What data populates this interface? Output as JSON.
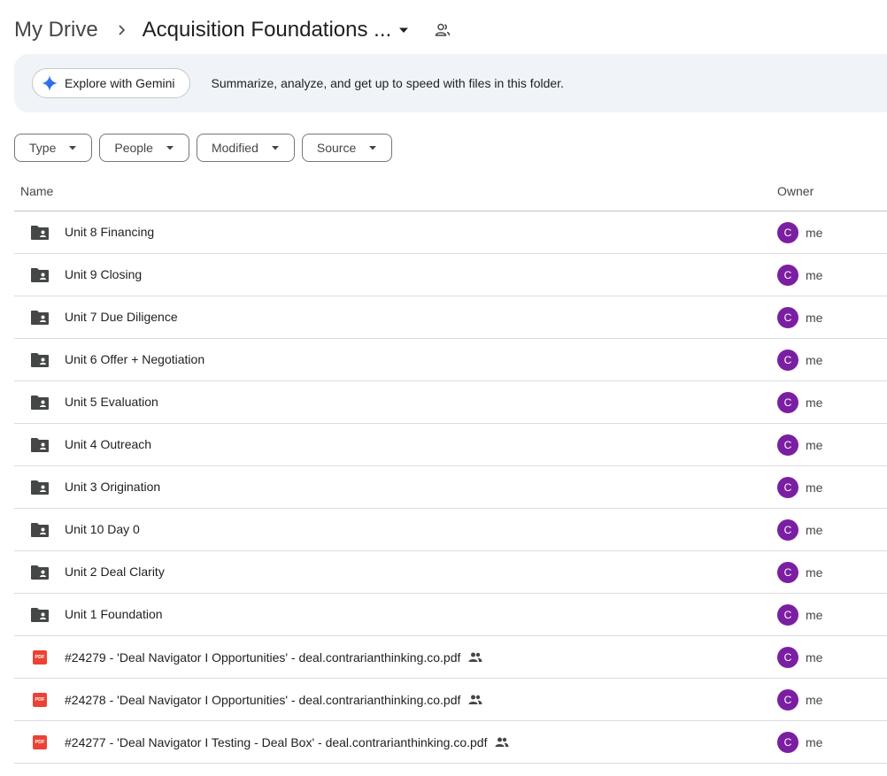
{
  "breadcrumb": {
    "root": "My Drive",
    "current": "Acquisition Foundations ..."
  },
  "gemini": {
    "button_label": "Explore with Gemini",
    "description": "Summarize, analyze, and get up to speed with files in this folder."
  },
  "filters": [
    "Type",
    "People",
    "Modified",
    "Source"
  ],
  "table": {
    "headers": {
      "name": "Name",
      "owner": "Owner"
    },
    "rows": [
      {
        "name": "Unit 8 Financing",
        "type": "shared-folder",
        "owner": "me",
        "avatar": "C",
        "shared": false
      },
      {
        "name": "Unit 9 Closing",
        "type": "shared-folder",
        "owner": "me",
        "avatar": "C",
        "shared": false
      },
      {
        "name": "Unit 7 Due Diligence",
        "type": "shared-folder",
        "owner": "me",
        "avatar": "C",
        "shared": false
      },
      {
        "name": "Unit 6 Offer + Negotiation",
        "type": "shared-folder",
        "owner": "me",
        "avatar": "C",
        "shared": false
      },
      {
        "name": "Unit 5 Evaluation",
        "type": "shared-folder",
        "owner": "me",
        "avatar": "C",
        "shared": false
      },
      {
        "name": "Unit 4 Outreach",
        "type": "shared-folder",
        "owner": "me",
        "avatar": "C",
        "shared": false
      },
      {
        "name": "Unit 3 Origination",
        "type": "shared-folder",
        "owner": "me",
        "avatar": "C",
        "shared": false
      },
      {
        "name": "Unit 10 Day 0",
        "type": "shared-folder",
        "owner": "me",
        "avatar": "C",
        "shared": false
      },
      {
        "name": "Unit 2 Deal Clarity",
        "type": "shared-folder",
        "owner": "me",
        "avatar": "C",
        "shared": false
      },
      {
        "name": "Unit 1 Foundation",
        "type": "shared-folder",
        "owner": "me",
        "avatar": "C",
        "shared": false
      },
      {
        "name": "#24279 - 'Deal Navigator I Opportunities' - deal.contrarianthinking.co.pdf",
        "type": "pdf",
        "owner": "me",
        "avatar": "C",
        "shared": true
      },
      {
        "name": "#24278 - 'Deal Navigator I Opportunities' - deal.contrarianthinking.co.pdf",
        "type": "pdf",
        "owner": "me",
        "avatar": "C",
        "shared": true
      },
      {
        "name": "#24277 - 'Deal Navigator I Testing - Deal Box' - deal.contrarianthinking.co.pdf",
        "type": "pdf",
        "owner": "me",
        "avatar": "C",
        "shared": true
      }
    ]
  },
  "icons": {
    "folder": "shared-folder-icon",
    "pdf": "pdf-icon",
    "pdf_label": "PDF",
    "shared": "people-icon"
  },
  "colors": {
    "avatar": "#7b1fa2",
    "banner_bg": "#f0f4f9",
    "pdf_red": "#ea4335",
    "folder": "#444746"
  }
}
